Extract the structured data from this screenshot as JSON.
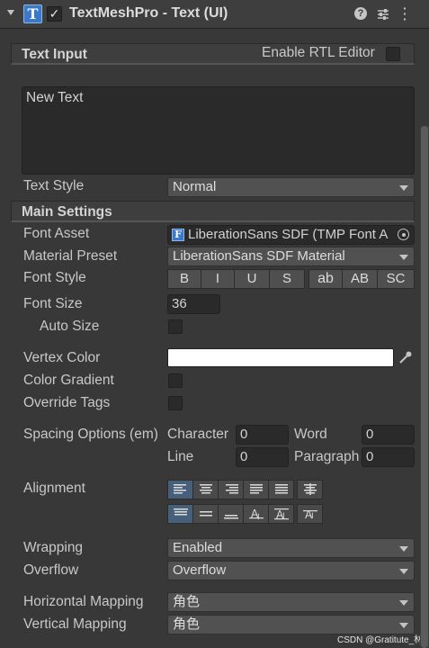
{
  "header": {
    "component_title": "TextMeshPro - Text (UI)",
    "enabled": true
  },
  "text_input": {
    "section_label": "Text Input",
    "rtl_label": "Enable RTL Editor",
    "value": "New Text"
  },
  "text_style": {
    "label": "Text Style",
    "value": "Normal"
  },
  "main_settings": {
    "section_label": "Main Settings",
    "font_asset": {
      "label": "Font Asset",
      "value": "LiberationSans SDF (TMP Font A"
    },
    "material_preset": {
      "label": "Material Preset",
      "value": "LiberationSans SDF Material"
    },
    "font_style": {
      "label": "Font Style",
      "buttons": [
        "B",
        "I",
        "U",
        "S",
        "ab",
        "AB",
        "SC"
      ]
    },
    "font_size": {
      "label": "Font Size",
      "value": "36"
    },
    "auto_size": {
      "label": "Auto Size"
    },
    "vertex_color": {
      "label": "Vertex Color",
      "value": "#ffffff"
    },
    "color_gradient": {
      "label": "Color Gradient"
    },
    "override_tags": {
      "label": "Override Tags"
    },
    "spacing": {
      "label": "Spacing Options (em)",
      "character_label": "Character",
      "character_value": "0",
      "word_label": "Word",
      "word_value": "0",
      "line_label": "Line",
      "line_value": "0",
      "paragraph_label": "Paragraph",
      "paragraph_value": "0"
    },
    "alignment": {
      "label": "Alignment"
    },
    "wrapping": {
      "label": "Wrapping",
      "value": "Enabled"
    },
    "overflow": {
      "label": "Overflow",
      "value": "Overflow"
    },
    "horizontal_mapping": {
      "label": "Horizontal Mapping",
      "value": "角色"
    },
    "vertical_mapping": {
      "label": "Vertical Mapping",
      "value": "角色"
    }
  },
  "watermark": "CSDN @Gratitute_林腾",
  "colors": {
    "accent": "#46607c",
    "panel": "#383838",
    "field": "#2a2a2a"
  },
  "icons": [
    "tmp-text-icon",
    "help-icon",
    "preset-icon",
    "more-icon",
    "object-picker-icon",
    "eyedropper-icon"
  ]
}
